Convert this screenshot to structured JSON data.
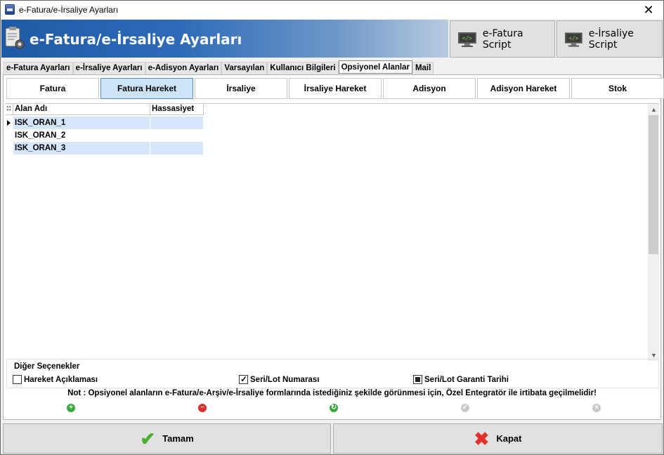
{
  "window": {
    "title": "e-Fatura/e-İrsaliye Ayarları",
    "close_glyph": "✕"
  },
  "banner": {
    "title": "e-Fatura/e-İrsaliye Ayarları",
    "script_buttons": [
      {
        "label": "e-Fatura Script",
        "icon": "monitor-code-icon"
      },
      {
        "label": "e-İrsaliye Script",
        "icon": "monitor-code-icon"
      }
    ]
  },
  "tabs": [
    {
      "label": "e-Fatura Ayarları"
    },
    {
      "label": "e-İrsaliye Ayarları"
    },
    {
      "label": "e-Adisyon Ayarları"
    },
    {
      "label": "Varsayılan"
    },
    {
      "label": "Kullanıcı Bilgileri"
    },
    {
      "label": "Opsiyonel Alanlar",
      "active": true
    },
    {
      "label": "Mail"
    }
  ],
  "subtabs": [
    {
      "label": "Fatura"
    },
    {
      "label": "Fatura Hareket",
      "active": true
    },
    {
      "label": "İrsaliye"
    },
    {
      "label": "İrsaliye Hareket"
    },
    {
      "label": "Adisyon"
    },
    {
      "label": "Adisyon Hareket"
    },
    {
      "label": "Stok"
    }
  ],
  "grid": {
    "indicator_header": "::",
    "columns": [
      "Alan Adı",
      "Hassasiyet"
    ],
    "rows": [
      {
        "alan_adi": "ISK_ORAN_1",
        "hassasiyet": ""
      },
      {
        "alan_adi": "ISK_ORAN_2",
        "hassasiyet": ""
      },
      {
        "alan_adi": "ISK_ORAN_3",
        "hassasiyet": ""
      }
    ]
  },
  "options": {
    "legend": "Diğer Seçenekler",
    "items": [
      {
        "label": "Hareket Açıklaması",
        "state": "unchecked"
      },
      {
        "label": "Seri/Lot Numarası",
        "state": "checked"
      },
      {
        "label": "Seri/Lot Garanti Tarihi",
        "state": "indeterminate"
      }
    ]
  },
  "note": "Not : Opsiyonel alanların e-Fatura/e-Arşiv/e-İrsaliye formlarında istediğiniz şekilde görünmesi için, Özel Entegratör ile irtibata geçilmelidir!",
  "navigator": [
    {
      "icon": "add-icon",
      "color": "#3aa83a",
      "glyph": "+"
    },
    {
      "icon": "remove-icon",
      "color": "#d9302c",
      "glyph": "−"
    },
    {
      "icon": "edit-icon",
      "color": "#3aa83a",
      "glyph": "↻"
    },
    {
      "icon": "confirm-icon",
      "color": "#c9c9c9",
      "glyph": "✓"
    },
    {
      "icon": "cancel-icon",
      "color": "#c9c9c9",
      "glyph": "×"
    }
  ],
  "footer": {
    "ok_label": "Tamam",
    "close_label": "Kapat",
    "ok_color": "#4caf2a",
    "close_color": "#e0312b"
  }
}
